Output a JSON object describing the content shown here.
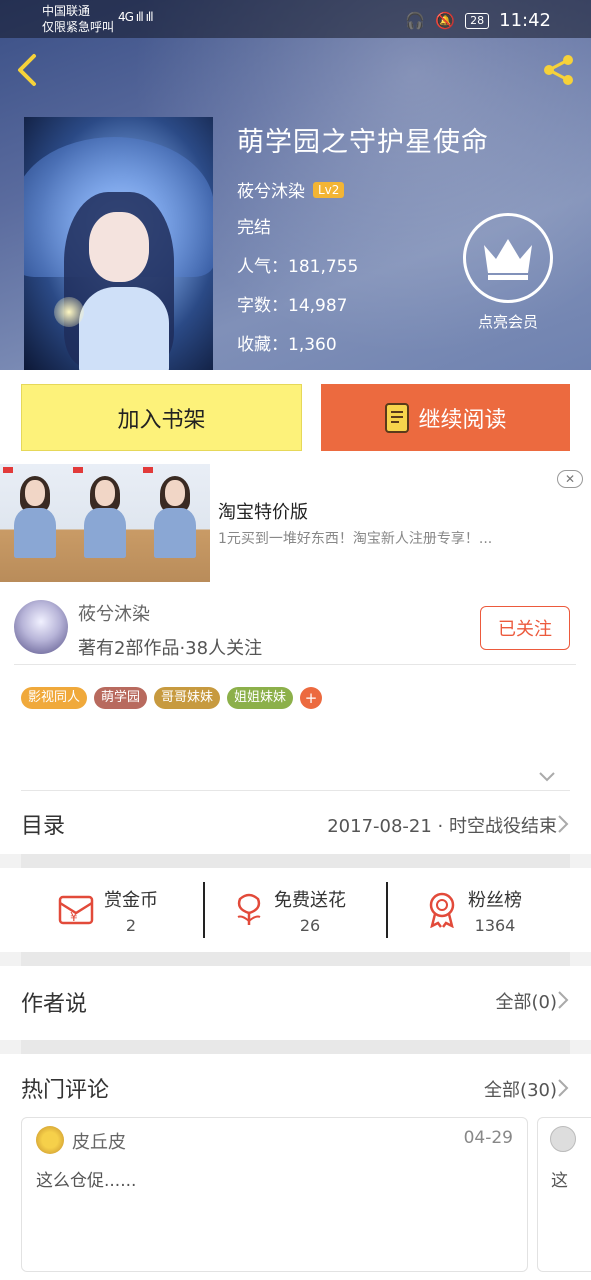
{
  "status_bar": {
    "carrier_line1": "中国联通",
    "carrier_line2": "仅限紧急呼叫",
    "signal_text": "4G ıll ıll",
    "battery": "28",
    "time": "11:42"
  },
  "book": {
    "title": "萌学园之守护星使命",
    "author": "莜兮沐染",
    "author_level": "Lv2",
    "status": "完结",
    "popularity": "人气：181,755",
    "word_count": "字数：14,987",
    "favorites": "收藏：1,360",
    "vip_label": "点亮会员"
  },
  "actions": {
    "add_shelf": "加入书架",
    "continue_read": "继续阅读"
  },
  "ad": {
    "title": "淘宝特价版",
    "description": "1元买到一堆好东西！淘宝新人注册专享！...",
    "close": "✕"
  },
  "author_card": {
    "name": "莜兮沐染",
    "summary": "著有2部作品·38人关注",
    "follow_label": "已关注",
    "tags": [
      {
        "label": "影视同人",
        "color": "#f0a93b"
      },
      {
        "label": "萌学园",
        "color": "#b86a5e"
      },
      {
        "label": "哥哥妹妹",
        "color": "#c79a3f"
      },
      {
        "label": "姐姐妹妹",
        "color": "#8cb04a"
      }
    ],
    "tag_more": "+"
  },
  "toc": {
    "title": "目录",
    "latest": "2017-08-21 · 时空战役结束"
  },
  "stats": {
    "reward": {
      "label": "赏金币",
      "value": "2"
    },
    "flowers": {
      "label": "免费送花",
      "value": "26"
    },
    "fans": {
      "label": "粉丝榜",
      "value": "1364"
    }
  },
  "author_says": {
    "title": "作者说",
    "all": "全部(0)"
  },
  "hot_comments": {
    "title": "热门评论",
    "all": "全部(30)",
    "items": [
      {
        "user": "皮丘皮",
        "date": "04-29",
        "text": "这么仓促......"
      },
      {
        "text": "这"
      }
    ]
  },
  "colors": {
    "accent_orange": "#ec6a3f",
    "shelf_yellow": "#fdf27a",
    "follow_red": "#ec5a3d"
  }
}
